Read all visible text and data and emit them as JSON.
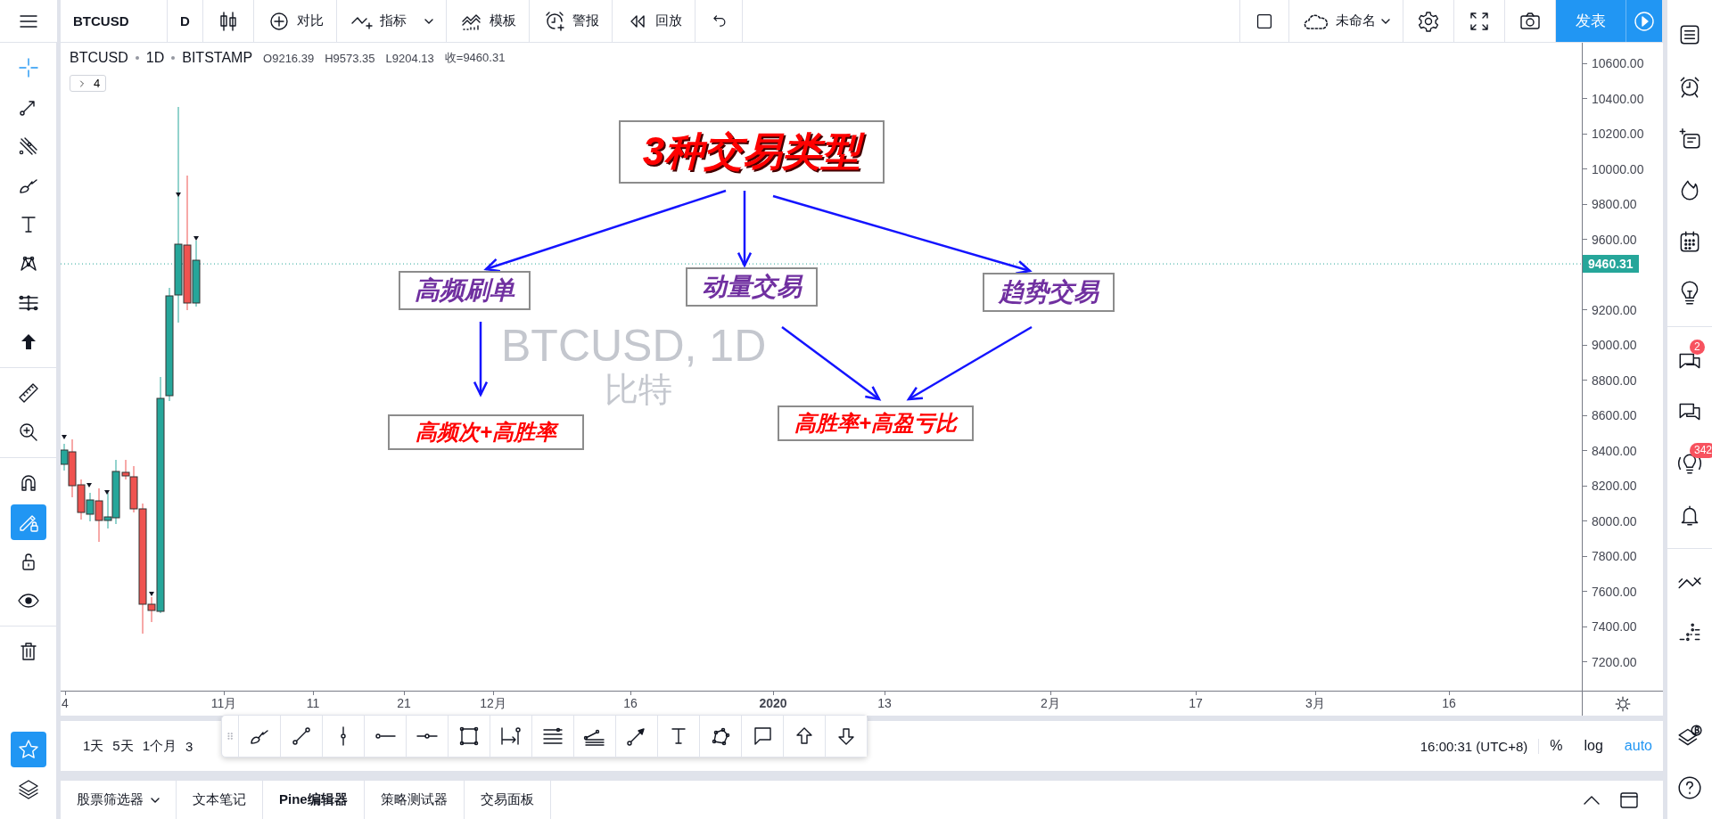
{
  "top_bar": {
    "symbol": "BTCUSD",
    "interval": "D",
    "tools": [
      {
        "label": "对比",
        "dropdown": false
      },
      {
        "label": "指标",
        "dropdown": true
      },
      {
        "label": "模板",
        "dropdown": false
      },
      {
        "label": "警报",
        "dropdown": false
      },
      {
        "label": "回放",
        "dropdown": false
      }
    ],
    "layout_name": "未命名",
    "publish": "发表"
  },
  "left_toolbar": {
    "tools": [
      {
        "kind": "tool",
        "selected": true
      },
      {
        "kind": "tool",
        "selected": false
      },
      {
        "kind": "tool",
        "selected": false
      },
      {
        "kind": "tool",
        "selected": false
      },
      {
        "kind": "tool",
        "selected": false
      },
      {
        "kind": "tool",
        "selected": false
      },
      {
        "kind": "tool",
        "selected": false
      },
      {
        "kind": "tool",
        "selected": false
      },
      {
        "kind": "tool",
        "selected": false
      },
      {
        "kind": "tool",
        "selected": false
      },
      {
        "kind": "toggle",
        "selected": false
      },
      {
        "kind": "toggle",
        "selected": true
      },
      {
        "kind": "toggle",
        "selected": false
      },
      {
        "kind": "toggle",
        "selected": false
      },
      {
        "kind": "tool",
        "selected": false
      },
      {
        "kind": "toggle",
        "selected": true
      },
      {
        "kind": "toggle",
        "selected": false
      }
    ]
  },
  "legend": {
    "symbol": "BTCUSD",
    "interval": "1D",
    "exchange": "BITSTAMP",
    "values": [
      "O9216.39",
      "H9573.35",
      "L9204.13",
      "收=9460.31"
    ],
    "indicator_count": "4"
  },
  "symbol_watermark": {
    "symbol": "BTCUSD, 1D",
    "description": "比特"
  },
  "annotations": [
    {
      "kind": "title",
      "text": "3种交易类型"
    },
    {
      "kind": "category",
      "text": "高频刷单"
    },
    {
      "kind": "category",
      "text": "动量交易"
    },
    {
      "kind": "category",
      "text": "趋势交易"
    },
    {
      "kind": "result",
      "text": "高频次+高胜率"
    },
    {
      "kind": "result",
      "text": "高胜率+高盈亏比"
    }
  ],
  "price_axis": {
    "labels": [
      "10600.00",
      "10400.00",
      "10200.00",
      "10000.00",
      "9800.00",
      "9600.00",
      "9200.00",
      "9000.00",
      "8800.00",
      "8600.00",
      "8400.00",
      "8200.00",
      "8000.00",
      "7800.00",
      "7600.00",
      "7400.00",
      "7200.00"
    ],
    "last_price": "9460.31"
  },
  "time_axis": {
    "labels": [
      {
        "text": "4",
        "kind": "tick"
      },
      {
        "text": "11月",
        "kind": "tick"
      },
      {
        "text": "11",
        "kind": "tick"
      },
      {
        "text": "21",
        "kind": "tick"
      },
      {
        "text": "12月",
        "kind": "tick"
      },
      {
        "text": "16",
        "kind": "tick"
      },
      {
        "text": "2020",
        "kind": "year"
      },
      {
        "text": "13",
        "kind": "tick"
      },
      {
        "text": "2月",
        "kind": "tick"
      },
      {
        "text": "17",
        "kind": "tick"
      },
      {
        "text": "3月",
        "kind": "tick"
      },
      {
        "text": "16",
        "kind": "tick"
      }
    ]
  },
  "bottom_bar": {
    "ranges": [
      "1天",
      "5天",
      "1个月",
      "3"
    ],
    "time": "16:00:31 (UTC+8)",
    "toggles": [
      {
        "label": "%",
        "on": false
      },
      {
        "label": "log",
        "on": false
      },
      {
        "label": "auto",
        "on": true
      }
    ]
  },
  "bottom_tabs": [
    {
      "label": "股票筛选器",
      "dropdown": true
    },
    {
      "label": "文本笔记",
      "dropdown": false
    },
    {
      "label": "Pine编辑器",
      "dropdown": false
    },
    {
      "label": "策略测试器",
      "dropdown": false
    },
    {
      "label": "交易面板",
      "dropdown": false
    }
  ],
  "right_sidebar": {
    "badges": [
      "2",
      "342"
    ]
  }
}
